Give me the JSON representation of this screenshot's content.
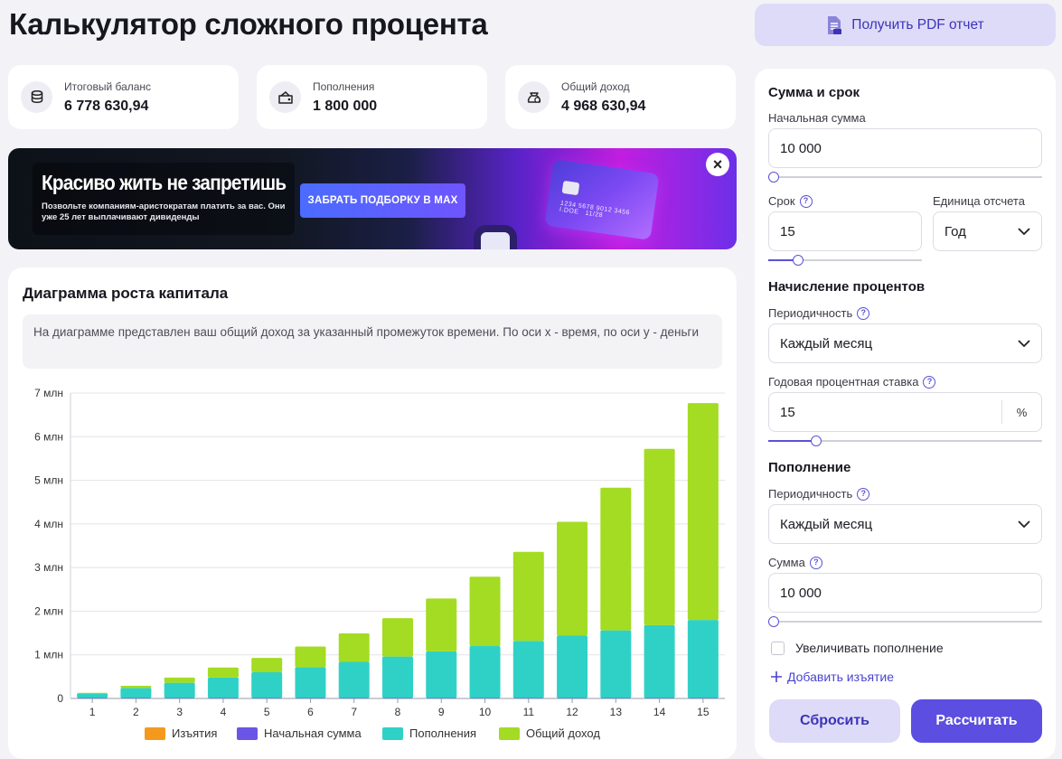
{
  "page": {
    "title": "Калькулятор сложного процента"
  },
  "pdf_button": {
    "label": "Получить PDF отчет",
    "icon": "pdf-document-icon"
  },
  "stats": [
    {
      "label": "Итоговый баланс",
      "value": "6 778 630,94",
      "icon": "coins-stack-icon"
    },
    {
      "label": "Пополнения",
      "value": "1 800 000",
      "icon": "wallet-icon"
    },
    {
      "label": "Общий доход",
      "value": "4 968 630,94",
      "icon": "money-bag-icon"
    }
  ],
  "banner": {
    "title": "Красиво жить не запретишь",
    "subtitle": "Позвольте компаниям-аристократам платить за вас. Они уже 25 лет выплачивают дивиденды",
    "cta": "ЗАБРАТЬ ПОДБОРКУ В MAX",
    "card_number": "1234 5678 9012 3456",
    "card_name": "I.DOE",
    "card_exp": "11/28",
    "close": "×"
  },
  "chart": {
    "title": "Диаграмма роста капитала",
    "note": "На диаграмме представлен ваш общий доход за указанный промежуток времени. По оси х - время, по оси у - деньги"
  },
  "chart_data": {
    "type": "bar",
    "stacked": true,
    "title": "Диаграмма роста капитала",
    "categories": [
      "1",
      "2",
      "3",
      "4",
      "5",
      "6",
      "7",
      "8",
      "9",
      "10",
      "11",
      "12",
      "13",
      "14",
      "15"
    ],
    "y_ticks": [
      "0",
      "1 млн",
      "2 млн",
      "3 млн",
      "4 млн",
      "5 млн",
      "6 млн",
      "7 млн"
    ],
    "ylim": [
      0,
      7000000
    ],
    "grid": true,
    "legend_position": "bottom",
    "series": [
      {
        "name": "Изъятия",
        "color": "#f39a1e",
        "values": [
          0,
          0,
          0,
          0,
          0,
          0,
          0,
          0,
          0,
          0,
          0,
          0,
          0,
          0,
          0
        ]
      },
      {
        "name": "Начальная сумма",
        "color": "#6a55e6",
        "values": [
          10000,
          10000,
          10000,
          10000,
          10000,
          10000,
          10000,
          10000,
          10000,
          10000,
          10000,
          10000,
          10000,
          10000,
          10000
        ]
      },
      {
        "name": "Пополнения",
        "color": "#2fd1c6",
        "values": [
          110000,
          230000,
          350000,
          470000,
          590000,
          710000,
          830000,
          950000,
          1070000,
          1190000,
          1310000,
          1430000,
          1550000,
          1670000,
          1790000
        ]
      },
      {
        "name": "Общий доход",
        "color": "#a3dc22",
        "values": [
          10000,
          50000,
          120000,
          230000,
          330000,
          470000,
          650000,
          880000,
          1210000,
          1590000,
          2040000,
          2610000,
          3270000,
          4040000,
          4968631
        ]
      }
    ]
  },
  "form": {
    "section_amount": "Сумма и срок",
    "initial_label": "Начальная сумма",
    "initial_value": "10 000",
    "initial_slider": 0.0,
    "term_label": "Срок",
    "term_value": "15",
    "term_slider": 0.17,
    "unit_label": "Единица отсчета",
    "unit_value": "Год",
    "section_interest": "Начисление процентов",
    "interest_period_label": "Периодичность",
    "interest_period_value": "Каждый месяц",
    "rate_label": "Годовая процентная ставка",
    "rate_value": "15",
    "rate_unit": "%",
    "rate_slider": 0.16,
    "section_topup": "Пополнение",
    "topup_period_label": "Периодичность",
    "topup_period_value": "Каждый месяц",
    "topup_amount_label": "Сумма",
    "topup_amount_value": "10 000",
    "topup_slider": 0.0,
    "increase_label": "Увеличивать пополнение",
    "add_withdrawal": "Добавить изъятие",
    "reset_button": "Сбросить",
    "calc_button": "Рассчитать",
    "help_glyph": "?"
  }
}
